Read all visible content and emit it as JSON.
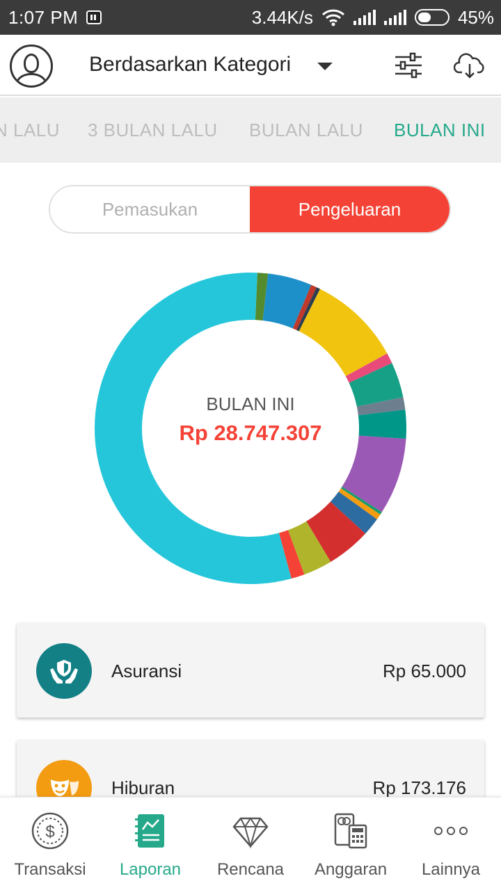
{
  "status_bar": {
    "time": "1:07 PM",
    "network_speed": "3.44K/s",
    "battery": "45%",
    "icons": [
      "bbm-icon",
      "wifi-icon",
      "signal-icon",
      "signal-icon",
      "battery-icon"
    ]
  },
  "header": {
    "title": "Berdasarkan Kategori",
    "icons": [
      "avatar-icon",
      "chevron-down-icon",
      "filter-sliders-icon",
      "cloud-download-icon"
    ]
  },
  "period_tabs": [
    {
      "label": "N LALU",
      "active": false
    },
    {
      "label": "3 BULAN LALU",
      "active": false
    },
    {
      "label": "BULAN LALU",
      "active": false
    },
    {
      "label": "BULAN INI",
      "active": true
    }
  ],
  "toggle": {
    "income_label": "Pemasukan",
    "expense_label": "Pengeluaran",
    "active": "expense"
  },
  "summary": {
    "label": "BULAN INI",
    "total": "Rp 28.747.307"
  },
  "chart_data": {
    "type": "pie",
    "variant": "donut",
    "unit": "percent",
    "slices": [
      {
        "value": 1.1,
        "color": "#558b2f"
      },
      {
        "value": 4.6,
        "color": "#1e90c9"
      },
      {
        "value": 0.6,
        "color": "#c0392b"
      },
      {
        "value": 0.4,
        "color": "#2c3e50"
      },
      {
        "value": 9.7,
        "color": "#f1c40f"
      },
      {
        "value": 1.1,
        "color": "#e84a7a"
      },
      {
        "value": 3.7,
        "color": "#16a085"
      },
      {
        "value": 1.3,
        "color": "#6d7f8e"
      },
      {
        "value": 3.0,
        "color": "#009688"
      },
      {
        "value": 8.0,
        "color": "#9b59b6"
      },
      {
        "value": 0.3,
        "color": "#1a9b6c"
      },
      {
        "value": 0.6,
        "color": "#f39c12"
      },
      {
        "value": 1.9,
        "color": "#2c6ca0"
      },
      {
        "value": 4.6,
        "color": "#d32f2f"
      },
      {
        "value": 3.0,
        "color": "#afb42b"
      },
      {
        "value": 1.4,
        "color": "#f44336"
      },
      {
        "value": 55.2,
        "color": "#26c6da"
      }
    ]
  },
  "categories": [
    {
      "name": "Asuransi",
      "amount": "Rp 65.000",
      "color": "#138086",
      "icon": "insurance-hands-shield-icon"
    },
    {
      "name": "Hiburan",
      "amount": "Rp 173.176",
      "color": "#f39c12",
      "icon": "theater-masks-icon"
    }
  ],
  "bottom_nav": [
    {
      "label": "Transaksi",
      "icon": "coin-dollar-icon",
      "active": false
    },
    {
      "label": "Laporan",
      "icon": "report-notebook-icon",
      "active": true
    },
    {
      "label": "Rencana",
      "icon": "diamond-icon",
      "active": false
    },
    {
      "label": "Anggaran",
      "icon": "wallet-calculator-icon",
      "active": false
    },
    {
      "label": "Lainnya",
      "icon": "more-dots-icon",
      "active": false
    }
  ],
  "colors": {
    "accent": "#26a98b",
    "expense": "#f44336"
  }
}
